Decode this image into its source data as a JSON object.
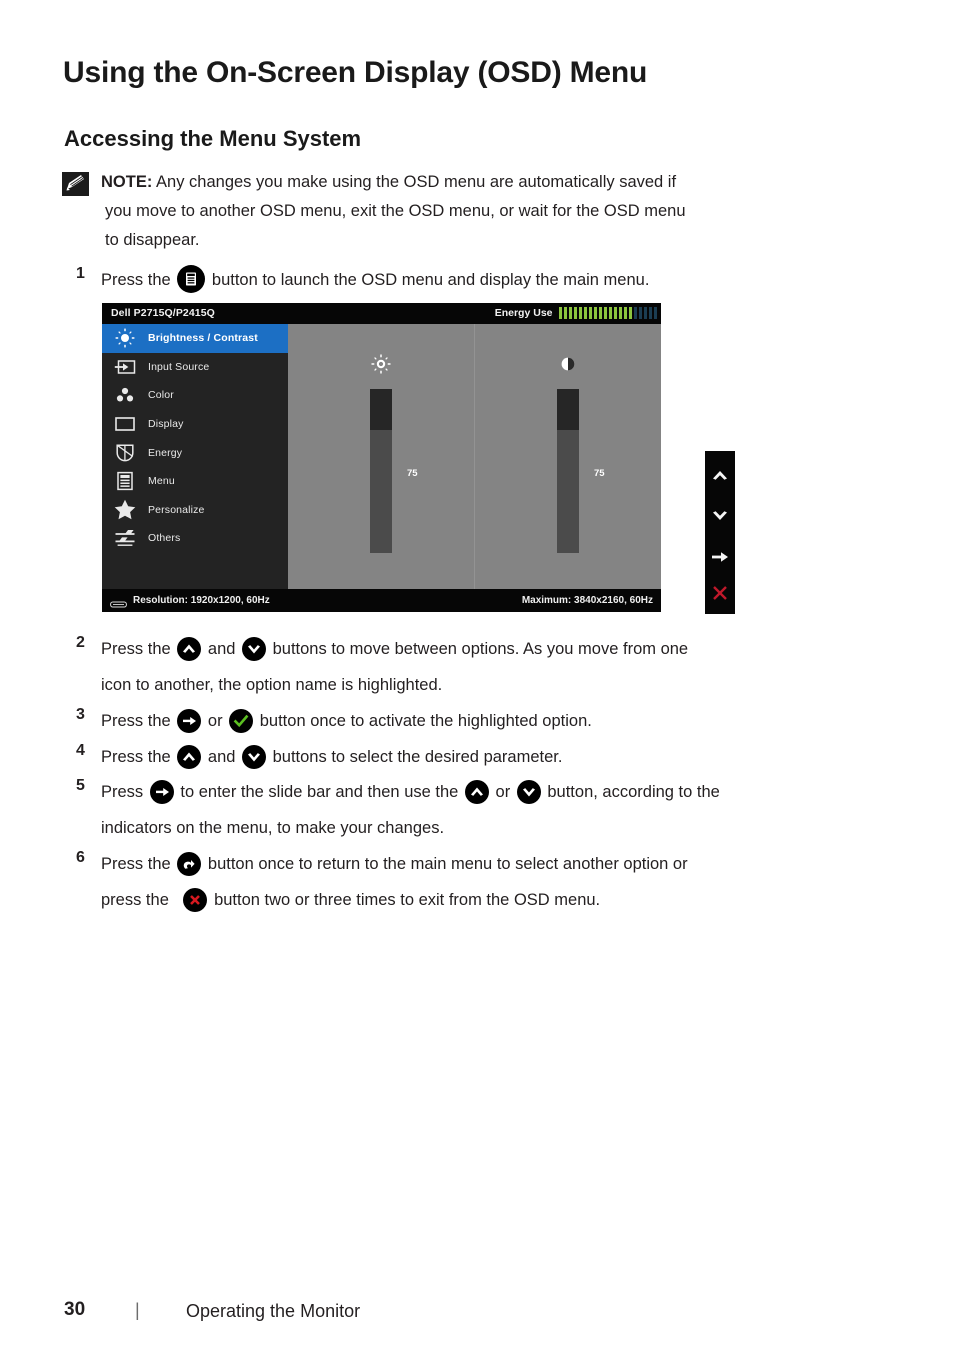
{
  "page": {
    "h1": "Using the On-Screen Display (OSD) Menu",
    "h2": "Accessing the Menu System"
  },
  "note": {
    "label": "NOTE:",
    "line1": "Any changes you make using the OSD menu are automatically saved if",
    "line2": "you move to another OSD menu, exit the OSD menu, or wait for the OSD menu",
    "line3": "to disappear.",
    "icon": "note-pencil-icon"
  },
  "steps": [
    {
      "num": "1",
      "pre": "Press the",
      "icons": [
        "menu-button-icon"
      ],
      "post": "button to launch the OSD menu and display the main menu.",
      "line2": ""
    },
    {
      "num": "2",
      "pre": "Press the",
      "mid": "and",
      "icons": [
        "up-arrow-icon",
        "down-arrow-icon"
      ],
      "post": "buttons to move between options. As you move from one",
      "line2": "icon to another, the option name is highlighted."
    },
    {
      "num": "3",
      "pre": "Press the",
      "mid": "or",
      "icons": [
        "right-arrow-icon",
        "green-check-icon"
      ],
      "post": "button once to activate the highlighted option.",
      "line2": ""
    },
    {
      "num": "4",
      "pre": "Press the",
      "mid": "and",
      "icons": [
        "up-arrow-icon",
        "down-arrow-icon"
      ],
      "post": "buttons to select the desired parameter.",
      "line2": ""
    },
    {
      "num": "5",
      "pre": "Press",
      "mid1": "to enter the slide bar and then use the",
      "mid2": "or",
      "icons": [
        "right-arrow-icon",
        "up-arrow-icon",
        "down-arrow-icon"
      ],
      "post": "button, according to the",
      "line2": "indicators on the menu, to make your changes."
    },
    {
      "num": "6",
      "pre": "Press the",
      "mid1": "button once to return to the main menu to select another option or",
      "line2pre": "press the",
      "line2post": "button two or three times to exit from the OSD menu.",
      "icons": [
        "back-arrow-icon",
        "red-x-icon"
      ]
    }
  ],
  "osd": {
    "model": "Dell P2715Q/P2415Q",
    "energy_label": "Energy Use",
    "energy_bars_filled": 15,
    "energy_bars_empty": 5,
    "energy_color_filled": "#8cc63e",
    "energy_color_empty": "#1b3d52",
    "highlight_color": "#1c6fc4",
    "menu_items": [
      {
        "label": "Brightness / Contrast",
        "icon": "brightness-icon",
        "active": true
      },
      {
        "label": "Input Source",
        "icon": "input-source-icon",
        "active": false
      },
      {
        "label": "Color",
        "icon": "color-icon",
        "active": false
      },
      {
        "label": "Display",
        "icon": "display-icon",
        "active": false
      },
      {
        "label": "Energy",
        "icon": "energy-leaf-icon",
        "active": false
      },
      {
        "label": "Menu",
        "icon": "menu-list-icon",
        "active": false
      },
      {
        "label": "Personalize",
        "icon": "personalize-star-icon",
        "active": false
      },
      {
        "label": "Others",
        "icon": "others-sliders-icon",
        "active": false
      }
    ],
    "sliders": [
      {
        "name": "brightness",
        "icon": "brightness-icon",
        "value": "75",
        "percent": 75
      },
      {
        "name": "contrast",
        "icon": "contrast-icon",
        "value": "75",
        "percent": 75
      }
    ],
    "resolution": "Resolution: 1920x1200, 60Hz",
    "maximum": "Maximum: 3840x2160, 60Hz",
    "resolution_icon": "monitor-icon"
  },
  "key_column": {
    "keys": [
      {
        "name": "up-arrow-icon"
      },
      {
        "name": "down-arrow-icon"
      },
      {
        "name": "right-arrow-icon"
      },
      {
        "name": "red-x-icon"
      }
    ],
    "x_color": "#c0192b"
  },
  "footer": {
    "page_number": "30",
    "separator": "|",
    "section": "Operating the Monitor"
  }
}
